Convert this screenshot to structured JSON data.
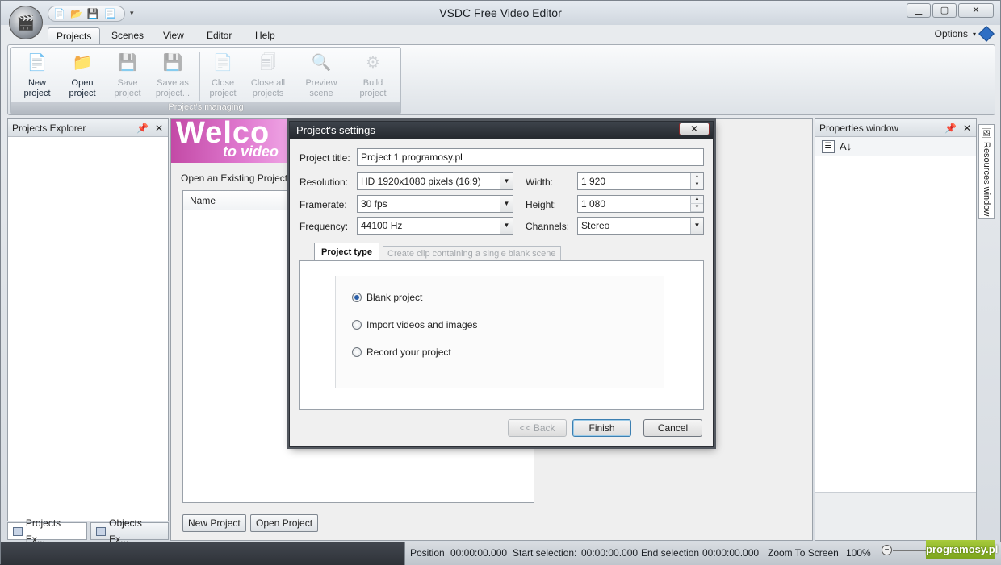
{
  "app": {
    "title": "VSDC Free Video Editor",
    "options_label": "Options"
  },
  "menu": {
    "tabs": [
      "Projects",
      "Scenes",
      "View",
      "Editor",
      "Help"
    ],
    "active": "Projects"
  },
  "ribbon": {
    "group_label": "Project's managing",
    "buttons": [
      {
        "line1": "New",
        "line2": "project",
        "enabled": true,
        "icon": "new-project-icon"
      },
      {
        "line1": "Open",
        "line2": "project",
        "enabled": true,
        "icon": "open-folder-icon"
      },
      {
        "line1": "Save",
        "line2": "project",
        "enabled": false,
        "icon": "save-disk-icon"
      },
      {
        "line1": "Save as",
        "line2": "project...",
        "enabled": false,
        "icon": "save-as-icon"
      },
      {
        "line1": "Close",
        "line2": "project",
        "enabled": false,
        "icon": "close-project-icon"
      },
      {
        "line1": "Close all",
        "line2": "projects",
        "enabled": false,
        "icon": "close-all-icon"
      },
      {
        "line1": "Preview",
        "line2": "scene",
        "enabled": false,
        "icon": "preview-icon"
      },
      {
        "line1": "Build",
        "line2": "project",
        "enabled": false,
        "icon": "build-icon"
      }
    ]
  },
  "projects_explorer": {
    "title": "Projects Explorer",
    "bottom_tabs": [
      "Projects Ex...",
      "Objects Ex..."
    ]
  },
  "start_page": {
    "banner_big": "Welco",
    "banner_small": "to video",
    "open_existing": "Open an Existing Project",
    "column_name": "Name",
    "new_project_button": "New Project",
    "open_project_button": "Open Project"
  },
  "properties": {
    "title": "Properties window"
  },
  "resources_tab": "Resources window",
  "dialog": {
    "title": "Project's settings",
    "project_title_label": "Project title:",
    "project_title_value": "Project 1 programosy.pl",
    "resolution_label": "Resolution:",
    "resolution_value": "HD 1920x1080 pixels (16:9)",
    "width_label": "Width:",
    "width_value": "1 920",
    "framerate_label": "Framerate:",
    "framerate_value": "30 fps",
    "height_label": "Height:",
    "height_value": "1 080",
    "frequency_label": "Frequency:",
    "frequency_value": "44100 Hz",
    "channels_label": "Channels:",
    "channels_value": "Stereo",
    "tabs": [
      "Project type",
      "Create clip containing a single blank scene"
    ],
    "radios": [
      {
        "label": "Blank project",
        "checked": true
      },
      {
        "label": "Import videos and images",
        "checked": false
      },
      {
        "label": "Record your project",
        "checked": false
      }
    ],
    "back_button": "<< Back",
    "finish_button": "Finish",
    "cancel_button": "Cancel"
  },
  "status": {
    "position_label": "Position",
    "position_value": "00:00:00.000",
    "start_label": "Start selection:",
    "start_value": "00:00:00.000",
    "end_label": "End selection",
    "end_value": "00:00:00.000",
    "zoom_label": "Zoom To Screen",
    "zoom_value": "100%"
  },
  "watermark": "programosy.pl"
}
